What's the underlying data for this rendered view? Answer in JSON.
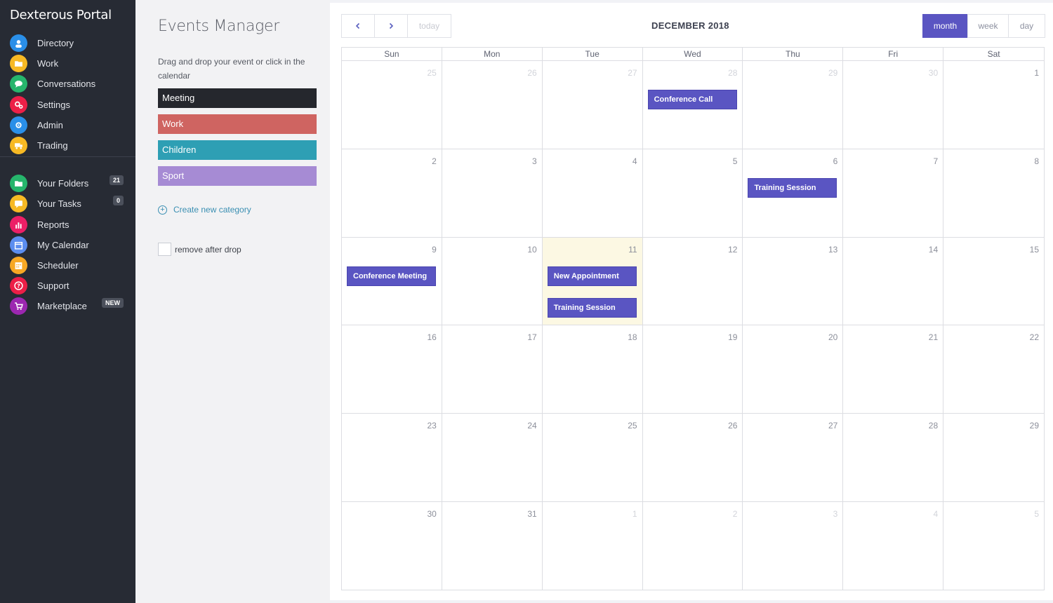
{
  "sidebar": {
    "brand": "Dexterous Portal",
    "items": [
      {
        "label": "Directory",
        "icon": "users-icon",
        "color": "#2a8fe8"
      },
      {
        "label": "Work",
        "icon": "folder-icon",
        "color": "#f7b924"
      },
      {
        "label": "Conversations",
        "icon": "chat-icon",
        "color": "#26b56c"
      },
      {
        "label": "Settings",
        "icon": "gears-icon",
        "color": "#ec1f47"
      },
      {
        "label": "Admin",
        "icon": "admin-icon",
        "color": "#2a8fe8"
      },
      {
        "label": "Trading",
        "icon": "truck-icon",
        "color": "#f7b924"
      }
    ],
    "items2": [
      {
        "label": "Your Folders",
        "icon": "folder-icon",
        "color": "#26b56c",
        "badge": "21"
      },
      {
        "label": "Your Tasks",
        "icon": "message-icon",
        "color": "#f7b924",
        "badge": "0"
      },
      {
        "label": "Reports",
        "icon": "chart-icon",
        "color": "#ec1f66"
      },
      {
        "label": "My Calendar",
        "icon": "calendar-icon",
        "color": "#5b8def"
      },
      {
        "label": "Scheduler",
        "icon": "schedule-icon",
        "color": "#f7a824"
      },
      {
        "label": "Support",
        "icon": "help-icon",
        "color": "#ec1f47"
      },
      {
        "label": "Marketplace",
        "icon": "cart-icon",
        "color": "#9c27b0",
        "badge": "NEW"
      }
    ]
  },
  "events_panel": {
    "title": "Events Manager",
    "description": "Drag and drop your event or click in the calendar",
    "categories": [
      {
        "label": "Meeting",
        "color": "#25272d"
      },
      {
        "label": "Work",
        "color": "#cf6461"
      },
      {
        "label": "Children",
        "color": "#2e9fb4"
      },
      {
        "label": "Sport",
        "color": "#a68bd4"
      }
    ],
    "create_label": "Create new category",
    "remove_label": "remove after drop"
  },
  "calendar": {
    "title": "DECEMBER 2018",
    "today_label": "today",
    "views": [
      "month",
      "week",
      "day"
    ],
    "active_view": "month",
    "dow": [
      "Sun",
      "Mon",
      "Tue",
      "Wed",
      "Thu",
      "Fri",
      "Sat"
    ],
    "today_date": "11",
    "weeks": [
      [
        {
          "n": "25",
          "o": true
        },
        {
          "n": "26",
          "o": true
        },
        {
          "n": "27",
          "o": true
        },
        {
          "n": "28",
          "o": true
        },
        {
          "n": "29",
          "o": true
        },
        {
          "n": "30",
          "o": true
        },
        {
          "n": "1",
          "o": false
        }
      ],
      [
        {
          "n": "2",
          "o": false
        },
        {
          "n": "3",
          "o": false
        },
        {
          "n": "4",
          "o": false
        },
        {
          "n": "5",
          "o": false
        },
        {
          "n": "6",
          "o": false
        },
        {
          "n": "7",
          "o": false
        },
        {
          "n": "8",
          "o": false
        }
      ],
      [
        {
          "n": "9",
          "o": false
        },
        {
          "n": "10",
          "o": false
        },
        {
          "n": "11",
          "o": false
        },
        {
          "n": "12",
          "o": false
        },
        {
          "n": "13",
          "o": false
        },
        {
          "n": "14",
          "o": false
        },
        {
          "n": "15",
          "o": false
        }
      ],
      [
        {
          "n": "16",
          "o": false
        },
        {
          "n": "17",
          "o": false
        },
        {
          "n": "18",
          "o": false
        },
        {
          "n": "19",
          "o": false
        },
        {
          "n": "20",
          "o": false
        },
        {
          "n": "21",
          "o": false
        },
        {
          "n": "22",
          "o": false
        }
      ],
      [
        {
          "n": "23",
          "o": false
        },
        {
          "n": "24",
          "o": false
        },
        {
          "n": "25",
          "o": false
        },
        {
          "n": "26",
          "o": false
        },
        {
          "n": "27",
          "o": false
        },
        {
          "n": "28",
          "o": false
        },
        {
          "n": "29",
          "o": false
        }
      ],
      [
        {
          "n": "30",
          "o": false
        },
        {
          "n": "31",
          "o": false
        },
        {
          "n": "1",
          "o": true
        },
        {
          "n": "2",
          "o": true
        },
        {
          "n": "3",
          "o": true
        },
        {
          "n": "4",
          "o": true
        },
        {
          "n": "5",
          "o": true
        }
      ]
    ],
    "events": [
      {
        "title": "Conference Call",
        "week": 0,
        "day": 3,
        "slot": 0
      },
      {
        "title": "Training Session",
        "week": 1,
        "day": 4,
        "slot": 0
      },
      {
        "title": "Conference Meeting",
        "week": 2,
        "day": 0,
        "slot": 0
      },
      {
        "title": "New Appointment",
        "week": 2,
        "day": 2,
        "slot": 0
      },
      {
        "title": "Training Session",
        "week": 2,
        "day": 2,
        "slot": 1
      }
    ]
  }
}
